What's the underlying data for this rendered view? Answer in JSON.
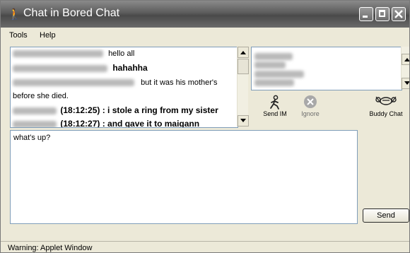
{
  "window": {
    "title": "Chat in Bored Chat"
  },
  "menu": {
    "items": [
      "Tools",
      "Help"
    ]
  },
  "chat": {
    "lines": [
      {
        "time": "",
        "text": "hello all",
        "bold": false
      },
      {
        "time": "",
        "text": "hahahha",
        "bold": true
      },
      {
        "time": "",
        "text": "but it was his mother's",
        "bold": false
      },
      {
        "time": "",
        "text": "before she died.",
        "bold": false
      },
      {
        "time": "(18:12:25)",
        "text": ": i stole a ring from my sister",
        "bold": true
      },
      {
        "time": "(18:12:27)",
        "text": ": and gave it to maigann",
        "bold": true
      }
    ]
  },
  "tools": {
    "send_im": "Send IM",
    "ignore": "Ignore",
    "buddy_chat": "Buddy Chat"
  },
  "compose": {
    "value": "what's up?"
  },
  "send": {
    "label": "Send"
  },
  "status": {
    "text": "Warning: Applet Window"
  }
}
